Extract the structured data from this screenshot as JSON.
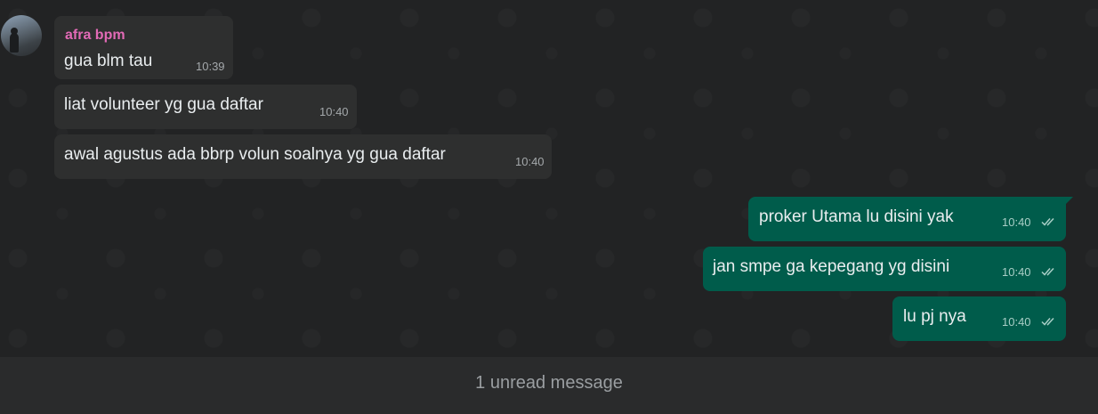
{
  "chat": {
    "incoming": [
      {
        "sender": "afra bpm",
        "text": "gua blm tau",
        "time": "10:39"
      },
      {
        "text": "liat volunteer yg gua daftar",
        "time": "10:40"
      },
      {
        "text": "awal agustus ada bbrp volun soalnya yg gua daftar",
        "time": "10:40"
      }
    ],
    "outgoing": [
      {
        "text": "proker Utama lu disini yak",
        "time": "10:40",
        "status_icon": "double-check-icon"
      },
      {
        "text": "jan smpe ga kepegang yg disini",
        "time": "10:40",
        "status_icon": "double-check-icon"
      },
      {
        "text": "lu pj nya",
        "time": "10:40",
        "status_icon": "double-check-icon"
      }
    ]
  },
  "unread": {
    "label": "1 unread message"
  },
  "colors": {
    "background": "#222324",
    "incoming_bubble": "#2e2f2f",
    "outgoing_bubble": "#005c4b",
    "sender_name": "#e26ab6"
  }
}
